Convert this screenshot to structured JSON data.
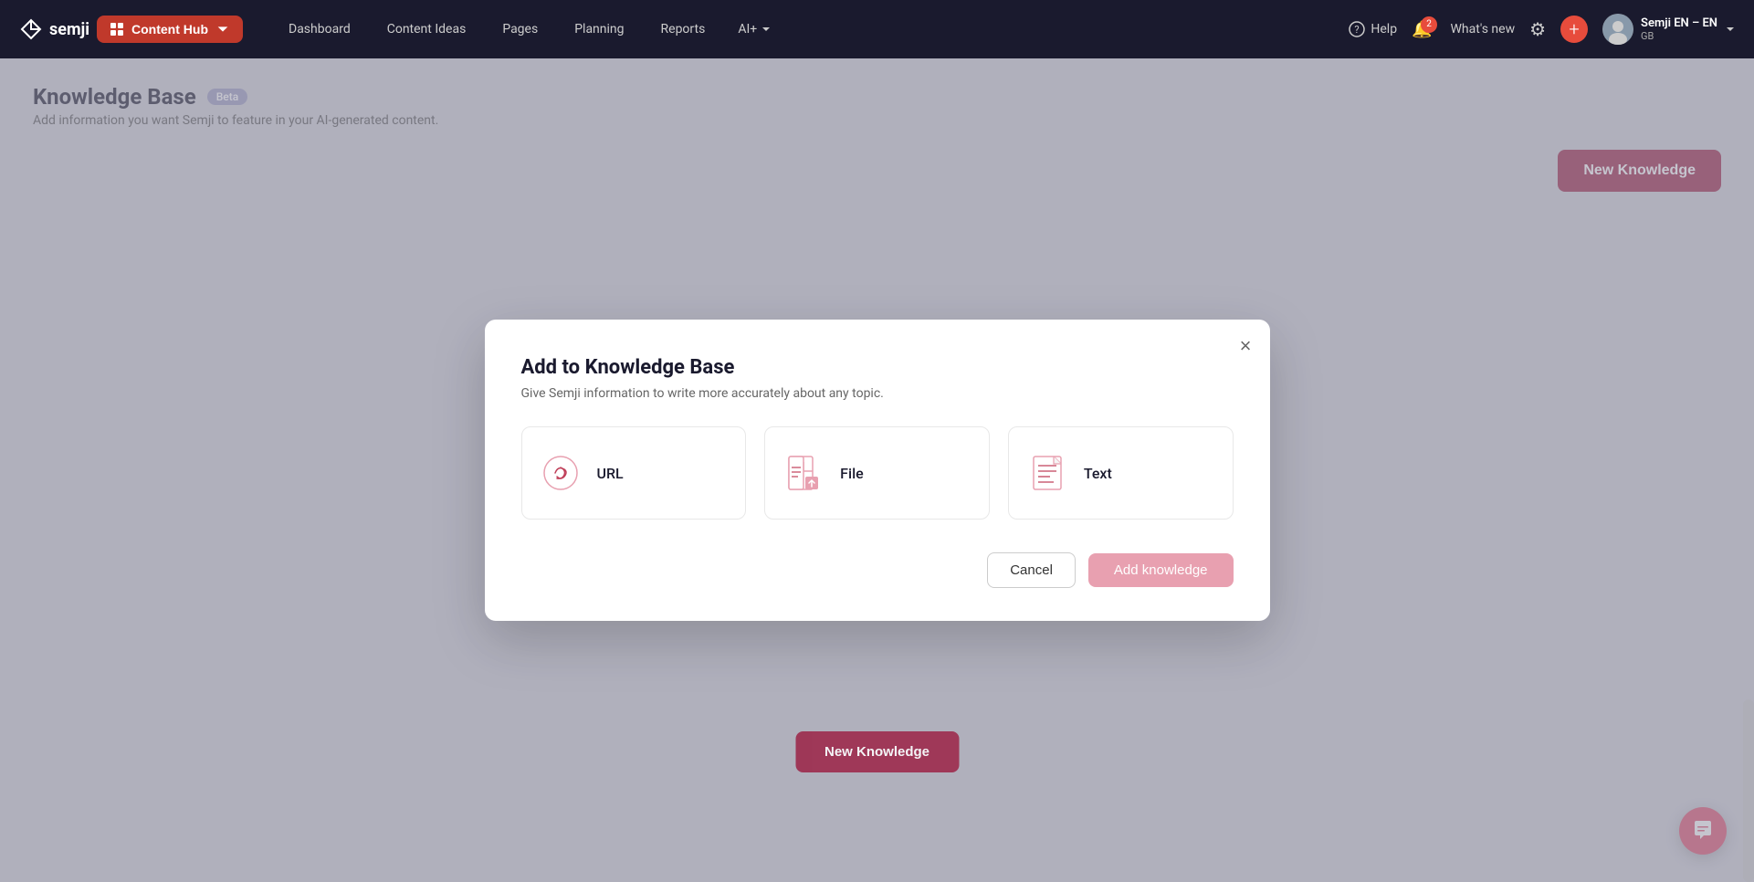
{
  "navbar": {
    "logo_text": "semji",
    "content_hub_label": "Content Hub",
    "nav_links": [
      {
        "label": "Dashboard",
        "id": "dashboard"
      },
      {
        "label": "Content Ideas",
        "id": "content-ideas"
      },
      {
        "label": "Pages",
        "id": "pages"
      },
      {
        "label": "Planning",
        "id": "planning"
      },
      {
        "label": "Reports",
        "id": "reports"
      },
      {
        "label": "AI+",
        "id": "ai"
      }
    ],
    "help_label": "Help",
    "whats_new_label": "What's new",
    "whats_new_badge": "2",
    "user_name": "Semji EN – EN",
    "user_locale": "GB"
  },
  "page": {
    "title": "Knowledge Base",
    "beta_label": "Beta",
    "subtitle": "Add information you want Semji to feature in your AI-generated content.",
    "new_knowledge_label": "New Knowledge"
  },
  "modal": {
    "title": "Add to Knowledge Base",
    "subtitle": "Give Semji information to write more accurately about any topic.",
    "close_label": "×",
    "options": [
      {
        "id": "url",
        "label": "URL"
      },
      {
        "id": "file",
        "label": "File"
      },
      {
        "id": "text",
        "label": "Text"
      }
    ],
    "cancel_label": "Cancel",
    "add_label": "Add knowledge"
  },
  "bg_button": {
    "label": "New Knowledge"
  }
}
